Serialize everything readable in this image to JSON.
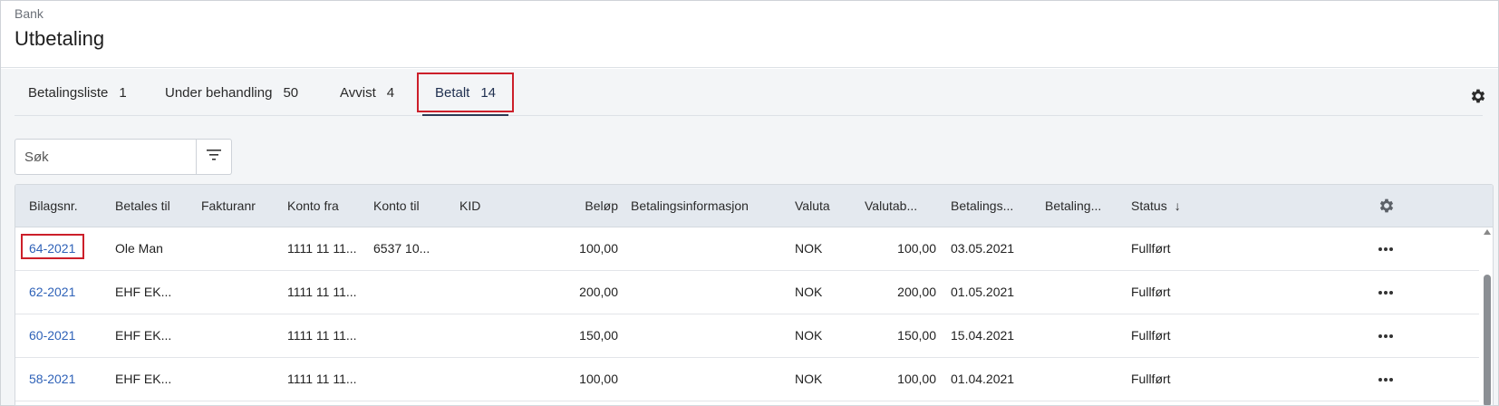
{
  "header": {
    "breadcrumb": "Bank",
    "title": "Utbetaling"
  },
  "tabs": [
    {
      "label": "Betalingsliste",
      "count": "1"
    },
    {
      "label": "Under behandling",
      "count": "50"
    },
    {
      "label": "Avvist",
      "count": "4"
    },
    {
      "label": "Betalt",
      "count": "14",
      "active": true
    }
  ],
  "search": {
    "placeholder": "Søk",
    "value": ""
  },
  "table": {
    "columns": [
      "Bilagsnr.",
      "Betales til",
      "Fakturanr",
      "Konto fra",
      "Konto til",
      "KID",
      "Beløp",
      "Betalingsinformasjon",
      "Valuta",
      "Valutab...",
      "Betalings...",
      "Betaling...",
      "Status"
    ],
    "sort_indicator": "↓",
    "rows": [
      {
        "bilagsnr": "64-2021",
        "betales_til": "Ole Man",
        "fakturanr": "",
        "konto_fra": "1111 11 11...",
        "konto_til": "6537 10...",
        "kid": "",
        "belop": "100,00",
        "betalingsinfo": "",
        "valuta": "NOK",
        "valutabelop": "100,00",
        "betalingsdato": "03.05.2021",
        "betaling": "",
        "status": "Fullført"
      },
      {
        "bilagsnr": "62-2021",
        "betales_til": "EHF EK...",
        "fakturanr": "",
        "konto_fra": "1111 11 11...",
        "konto_til": "",
        "kid": "",
        "belop": "200,00",
        "betalingsinfo": "",
        "valuta": "NOK",
        "valutabelop": "200,00",
        "betalingsdato": "01.05.2021",
        "betaling": "",
        "status": "Fullført"
      },
      {
        "bilagsnr": "60-2021",
        "betales_til": "EHF EK...",
        "fakturanr": "",
        "konto_fra": "1111 11 11...",
        "konto_til": "",
        "kid": "",
        "belop": "150,00",
        "betalingsinfo": "",
        "valuta": "NOK",
        "valutabelop": "150,00",
        "betalingsdato": "15.04.2021",
        "betaling": "",
        "status": "Fullført"
      },
      {
        "bilagsnr": "58-2021",
        "betales_til": "EHF EK...",
        "fakturanr": "",
        "konto_fra": "1111 11 11...",
        "konto_til": "",
        "kid": "",
        "belop": "100,00",
        "betalingsinfo": "",
        "valuta": "NOK",
        "valutabelop": "100,00",
        "betalingsdato": "01.04.2021",
        "betaling": "",
        "status": "Fullført"
      }
    ]
  },
  "icons": {
    "settings": "gear-icon",
    "filter": "filter-icon",
    "more": "more-horizontal-icon"
  },
  "colors": {
    "link": "#2f62b8",
    "highlight": "#cc1f2a",
    "active_tab_underline": "#2b3a55",
    "table_header_bg": "#e4e9ef"
  }
}
